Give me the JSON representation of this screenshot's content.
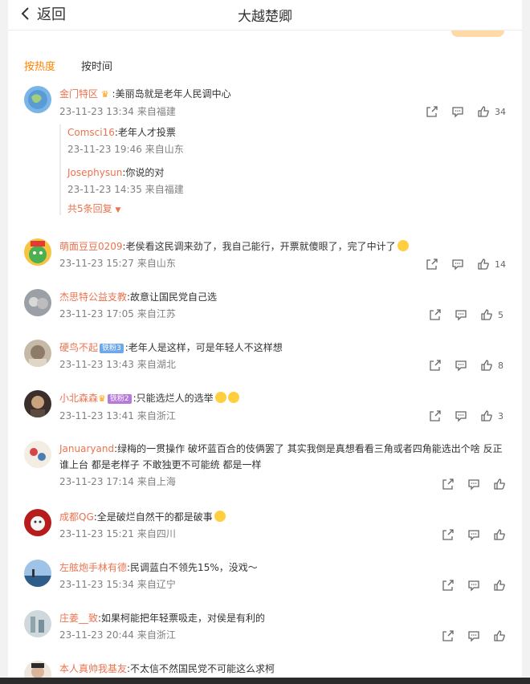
{
  "header": {
    "back_label": "返回",
    "title": "大越楚卿"
  },
  "sort": {
    "hot": "按热度",
    "time": "按时间"
  },
  "comments": [
    {
      "user": "金门特区",
      "text": ":美丽岛就是老年人民调中心",
      "time": "23-11-23 13:34",
      "location": "来自福建",
      "likes": "34",
      "replies": [
        {
          "user": "Comsci16",
          "text": ":老年人才投票",
          "time": "23-11-23 19:46",
          "location": "来自山东"
        },
        {
          "user": "Josephysun",
          "text": ":你说的对",
          "time": "23-11-23 14:35",
          "location": "来自福建"
        }
      ],
      "more": "共5条回复"
    },
    {
      "user": "萌面豆豆0209",
      "text": ":老侯看这民调来劲了，我自己能行，开票就傻眼了，完了中计了",
      "time": "23-11-23 15:27",
      "location": "来自山东",
      "likes": "14"
    },
    {
      "user": "杰思特公益支教",
      "text": ":故意让国民党自己选",
      "time": "23-11-23 17:05",
      "location": "来自江苏",
      "likes": "5"
    },
    {
      "user": "硬鸟不起",
      "badge": "铁粉3",
      "text": ":老年人是这样，可是年轻人不这样想",
      "time": "23-11-23 13:43",
      "location": "来自湖北",
      "likes": "8"
    },
    {
      "user": "小北森森",
      "badge": "铁粉2",
      "text": ":只能选烂人的选举",
      "time": "23-11-23 13:41",
      "location": "来自浙江",
      "likes": "3"
    },
    {
      "user": "Januaryand",
      "text": ":绿梅的一贯操作 破坏蓝百合的伎俩罢了 其实我倒是真想看看三角或者四角能选出个啥 反正谁上台 都是老样子 不敢独更不可能统 都是一样",
      "time": "23-11-23 17:14",
      "location": "来自上海",
      "likes": ""
    },
    {
      "user": "成都QG",
      "text": ":全是破烂自然干的都是破事",
      "time": "23-11-23 15:21",
      "location": "来自四川",
      "likes": ""
    },
    {
      "user": "左舷炮手林有德",
      "text": ":民调蓝白不领先15%，没戏～",
      "time": "23-11-23 15:34",
      "location": "来自辽宁",
      "likes": ""
    },
    {
      "user": "庄姜__致",
      "text": ":如果柯能把年轻票吸走，对侯是有利的",
      "time": "23-11-23 20:44",
      "location": "来自浙江",
      "likes": ""
    },
    {
      "user": "本人真帅我基友",
      "text": ":不太信不然国民党不可能这么求柯",
      "time": "",
      "location": "",
      "likes": ""
    }
  ],
  "colors": {
    "username": "#eb7350",
    "accent": "#ff8200",
    "meta": "#808080"
  }
}
